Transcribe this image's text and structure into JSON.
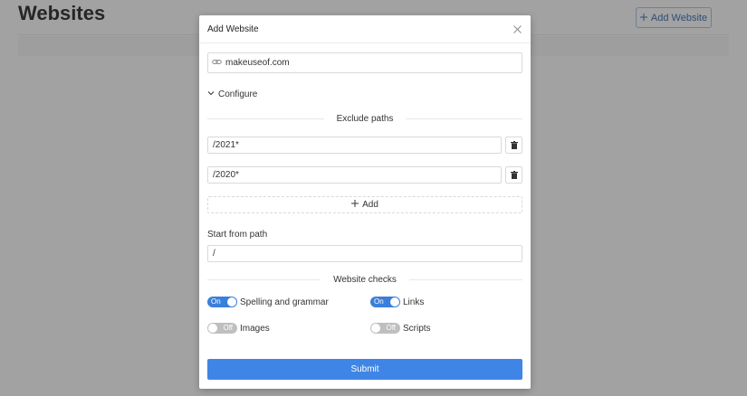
{
  "page": {
    "title": "Websites",
    "add_button": "Add Website"
  },
  "modal": {
    "title": "Add Website",
    "url_value": "makeuseof.com",
    "configure_label": "Configure",
    "exclude_paths": {
      "heading": "Exclude paths",
      "paths": [
        "/2021*",
        "/2020*"
      ],
      "add_label": "Add"
    },
    "start_from_path": {
      "label": "Start from path",
      "value": "/"
    },
    "website_checks": {
      "heading": "Website checks",
      "items": [
        {
          "label": "Spelling and grammar",
          "state": "On"
        },
        {
          "label": "Links",
          "state": "On"
        },
        {
          "label": "Images",
          "state": "Off"
        },
        {
          "label": "Scripts",
          "state": "Off"
        }
      ]
    },
    "submit_label": "Submit"
  },
  "colors": {
    "accent": "#3f85e6",
    "toggle_on": "#3a7fdb",
    "toggle_off": "#bfbfbf",
    "overlay": "#a2a2a2"
  }
}
